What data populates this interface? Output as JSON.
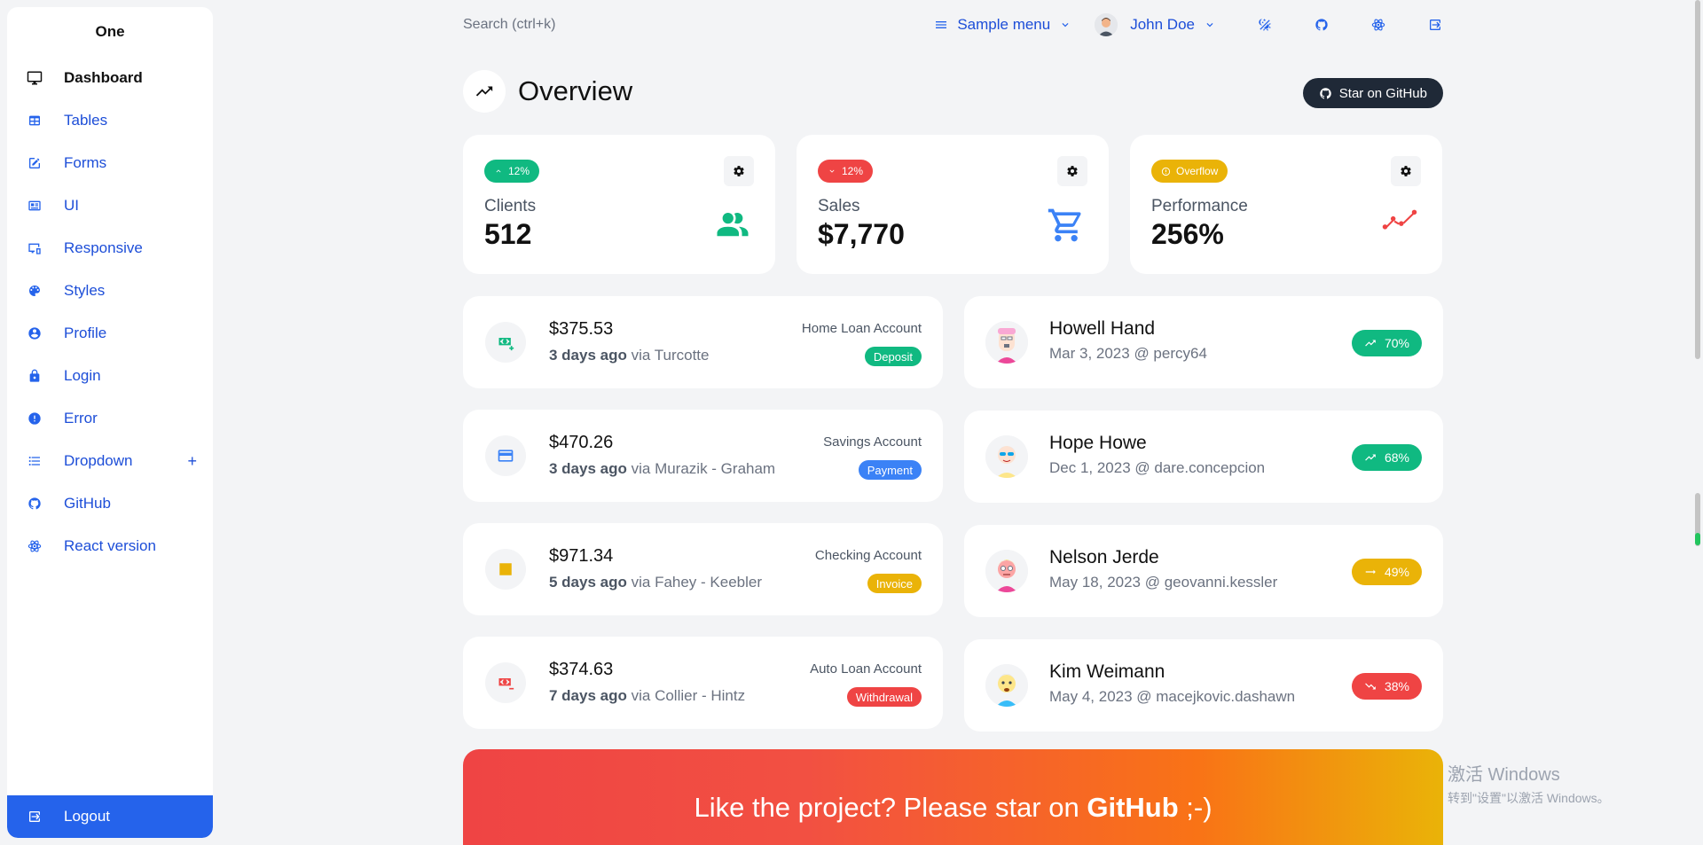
{
  "sidebar": {
    "brand": "One",
    "items": [
      {
        "label": "Dashboard",
        "icon": "monitor-icon",
        "active": true
      },
      {
        "label": "Tables",
        "icon": "table-icon"
      },
      {
        "label": "Forms",
        "icon": "edit-icon"
      },
      {
        "label": "UI",
        "icon": "ui-card-icon"
      },
      {
        "label": "Responsive",
        "icon": "responsive-icon"
      },
      {
        "label": "Styles",
        "icon": "palette-icon"
      },
      {
        "label": "Profile",
        "icon": "account-circle-icon"
      },
      {
        "label": "Login",
        "icon": "lock-icon"
      },
      {
        "label": "Error",
        "icon": "alert-circle-icon"
      },
      {
        "label": "Dropdown",
        "icon": "list-icon",
        "expand": "+"
      },
      {
        "label": "GitHub",
        "icon": "github-icon"
      },
      {
        "label": "React version",
        "icon": "react-icon"
      }
    ],
    "logout_label": "Logout"
  },
  "topbar": {
    "search_placeholder": "Search (ctrl+k)",
    "sample_menu_label": "Sample menu",
    "user_name": "John Doe"
  },
  "overview": {
    "title": "Overview",
    "star_button_label": "Star on GitHub"
  },
  "stats": [
    {
      "label": "Clients",
      "value": "512",
      "badge": "12%",
      "badge_color": "#10b981",
      "trend": "up",
      "icon": "account-group-icon",
      "icon_color": "#10b981"
    },
    {
      "label": "Sales",
      "value": "$7,770",
      "badge": "12%",
      "badge_color": "#ef4444",
      "trend": "down",
      "icon": "cart-icon",
      "icon_color": "#3b82f6"
    },
    {
      "label": "Performance",
      "value": "256%",
      "badge": "Overflow",
      "badge_color": "#eab308",
      "trend": "alert",
      "icon": "chart-timeline-icon",
      "icon_color": "#ef4444"
    }
  ],
  "transactions": [
    {
      "amount": "$375.53",
      "when": "3 days ago",
      "via": "via Turcotte",
      "account": "Home Loan Account",
      "type": "Deposit",
      "type_color": "#10b981",
      "icon": "cash-plus-icon",
      "icon_color": "#10b981"
    },
    {
      "amount": "$470.26",
      "when": "3 days ago",
      "via": "via Murazik - Graham",
      "account": "Savings Account",
      "type": "Payment",
      "type_color": "#3b82f6",
      "icon": "credit-card-icon",
      "icon_color": "#3b82f6"
    },
    {
      "amount": "$971.34",
      "when": "5 days ago",
      "via": "via Fahey - Keebler",
      "account": "Checking Account",
      "type": "Invoice",
      "type_color": "#eab308",
      "icon": "receipt-icon",
      "icon_color": "#eab308"
    },
    {
      "amount": "$374.63",
      "when": "7 days ago",
      "via": "via Collier - Hintz",
      "account": "Auto Loan Account",
      "type": "Withdrawal",
      "type_color": "#ef4444",
      "icon": "cash-minus-icon",
      "icon_color": "#ef4444"
    }
  ],
  "clients": [
    {
      "name": "Howell Hand",
      "meta": "Mar 3, 2023 @ percy64",
      "progress": "70%",
      "trend": "up",
      "trend_color": "#10b981"
    },
    {
      "name": "Hope Howe",
      "meta": "Dec 1, 2023 @ dare.concepcion",
      "progress": "68%",
      "trend": "up",
      "trend_color": "#10b981"
    },
    {
      "name": "Nelson Jerde",
      "meta": "May 18, 2023 @ geovanni.kessler",
      "progress": "49%",
      "trend": "neutral",
      "trend_color": "#eab308"
    },
    {
      "name": "Kim Weimann",
      "meta": "May 4, 2023 @ macejkovic.dashawn",
      "progress": "38%",
      "trend": "down",
      "trend_color": "#ef4444"
    }
  ],
  "banner": {
    "text_before": "Like the project? Please star on ",
    "text_bold": "GitHub",
    "text_after": " ;-)"
  },
  "watermark": {
    "line1": "激活 Windows",
    "line2": "转到\"设置\"以激活 Windows。"
  }
}
